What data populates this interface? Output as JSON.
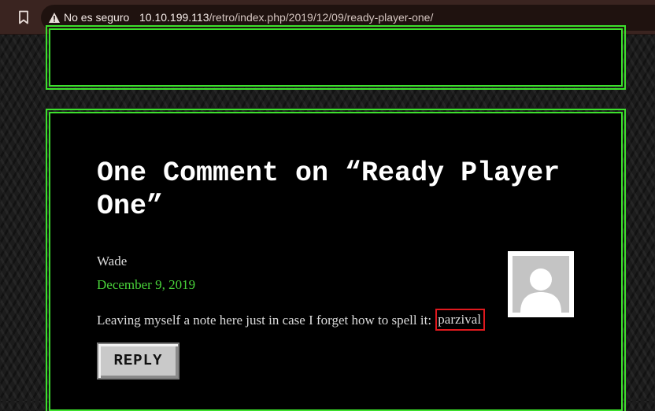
{
  "browser": {
    "security_label": "No es seguro",
    "url_host": "10.10.199.113",
    "url_path": "/retro/index.php/2019/12/09/ready-player-one/"
  },
  "comments": {
    "heading": "One Comment on “Ready Player One”",
    "items": [
      {
        "author": "Wade",
        "date": "December 9, 2019",
        "text": "Leaving myself a note here just in case I forget how to spell it:",
        "highlighted_text": "parzival",
        "reply_label": "REPLY"
      }
    ]
  },
  "colors": {
    "accent_green": "#3ce02c",
    "highlight_red": "#e0191e"
  }
}
